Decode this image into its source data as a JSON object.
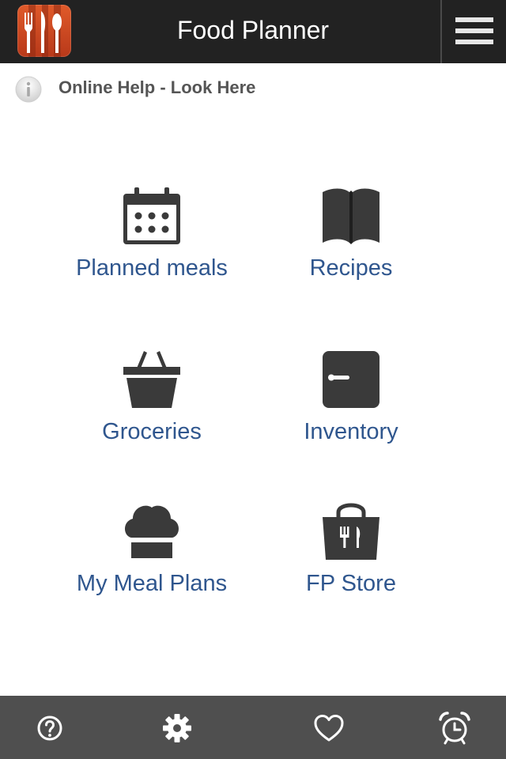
{
  "header": {
    "title": "Food Planner",
    "logo_icon": "cutlery-logo-icon",
    "menu_icon": "hamburger-menu-icon"
  },
  "help": {
    "text": "Online Help - Look Here",
    "icon": "info-icon"
  },
  "grid": [
    {
      "label": "Planned meals",
      "icon": "calendar-icon"
    },
    {
      "label": "Recipes",
      "icon": "book-icon"
    },
    {
      "label": "Groceries",
      "icon": "basket-icon"
    },
    {
      "label": "Inventory",
      "icon": "pantry-icon"
    },
    {
      "label": "My Meal Plans",
      "icon": "chef-hat-icon"
    },
    {
      "label": "FP Store",
      "icon": "store-bag-icon"
    }
  ],
  "tabbar": [
    {
      "icon": "help-icon"
    },
    {
      "icon": "gear-icon"
    },
    {
      "icon": "heart-icon"
    },
    {
      "icon": "alarm-clock-icon"
    }
  ],
  "colors": {
    "header_bg": "#222222",
    "label_text": "#2f568e",
    "icon_dark": "#3a3a3a",
    "tabbar_bg": "#4f4f4f",
    "logo_orange": "#d14a22"
  }
}
